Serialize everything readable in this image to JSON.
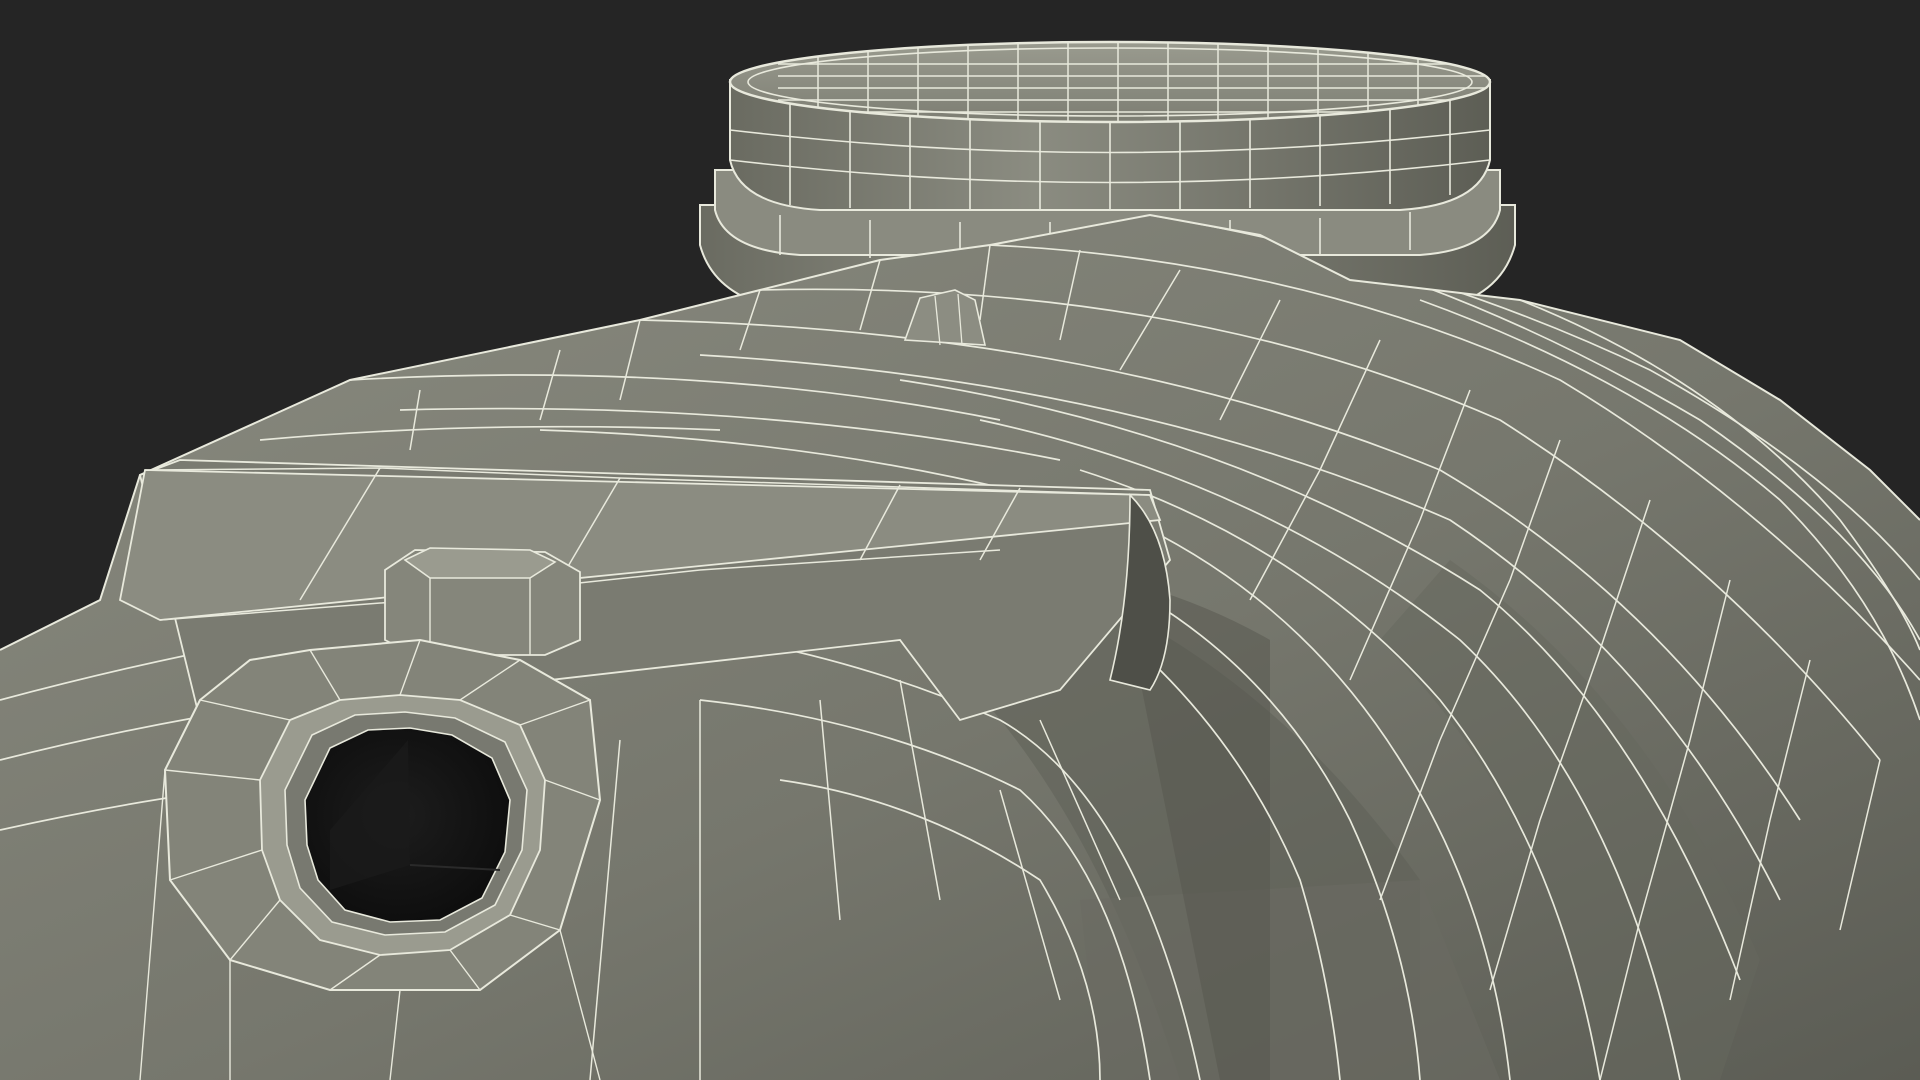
{
  "scene": {
    "subject": "septic-tank-wireframe-render",
    "colors": {
      "background": "#252525",
      "surface": "#7c7d72",
      "surface_dark": "#5d5e55",
      "surface_light": "#999a8e",
      "wire": "#e8e9dc",
      "hole": "#141414"
    }
  }
}
